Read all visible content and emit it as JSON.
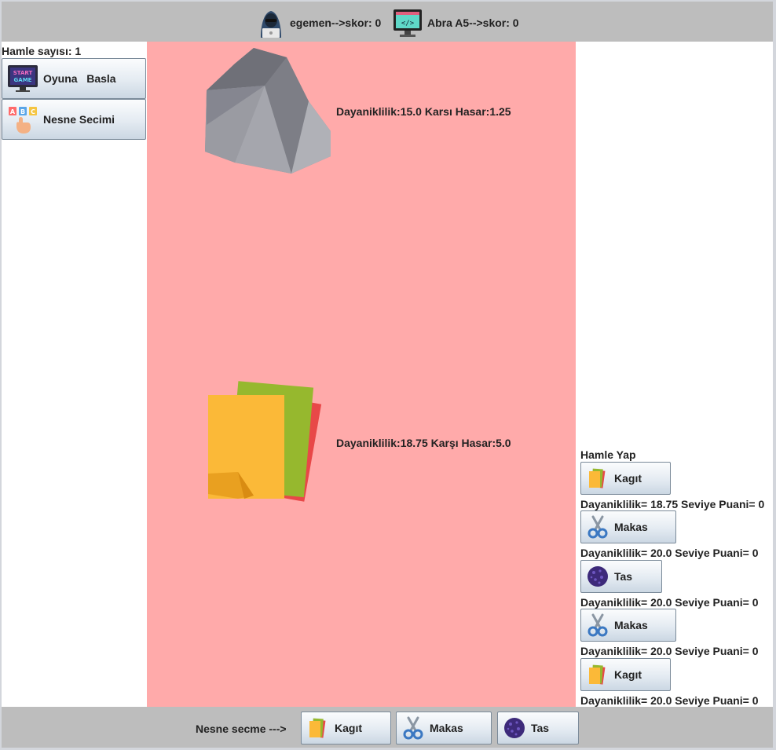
{
  "header": {
    "player_label": "egemen-->skor: 0",
    "computer_label": "Abra A5-->skor: 0"
  },
  "left_panel": {
    "move_count": "Hamle sayısı: 1",
    "start_button": "Oyuna   Basla",
    "select_button": "Nesne Secimi"
  },
  "arena": {
    "top_stats": "Dayaniklilik:15.0 Karsı Hasar:1.25",
    "bottom_stats": "Dayaniklilik:18.75 Karşı Hasar:5.0"
  },
  "right_panel": {
    "title": "Hamle Yap",
    "cards": [
      {
        "label": "Kagıt",
        "icon": "paper-icon",
        "stats": "Dayaniklilik= 18.75  Seviye Puani= 0"
      },
      {
        "label": "Makas",
        "icon": "scissors-icon",
        "stats": "Dayaniklilik= 20.0  Seviye Puani= 0"
      },
      {
        "label": "Tas",
        "icon": "rock-icon",
        "stats": "Dayaniklilik= 20.0  Seviye Puani= 0"
      },
      {
        "label": "Makas",
        "icon": "scissors-icon",
        "stats": "Dayaniklilik= 20.0  Seviye Puani= 0"
      },
      {
        "label": "Kagıt",
        "icon": "paper-icon",
        "stats": "Dayaniklilik= 20.0  Seviye Puani= 0"
      }
    ]
  },
  "bottom_bar": {
    "prompt": "Nesne secme --->",
    "paper_button": "Kagıt",
    "scissors_button": "Makas",
    "rock_button": "Tas"
  },
  "colors": {
    "arena_bg": "#ffaaaa",
    "bar_bg": "#bdbdbd"
  }
}
